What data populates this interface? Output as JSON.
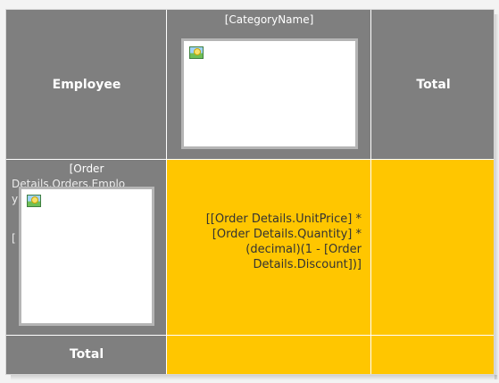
{
  "header_row": {
    "employee_label": "Employee",
    "category_placeholder": "[CategoryName]",
    "total_label": "Total"
  },
  "data_row": {
    "order_placeholder_top": "[Order",
    "order_placeholder_hidden_line1": "Details.Orders.Emplo",
    "order_placeholder_hidden_line2": "y",
    "order_placeholder_hidden_line3": "",
    "order_placeholder_hidden_line4": "[",
    "expression": "[[Order Details.UnitPrice] * [Order Details.Quantity] * (decimal)(1 - [Order Details.Discount])]"
  },
  "footer_row": {
    "total_label": "Total"
  },
  "icons": {
    "picture": "picture-icon"
  },
  "colors": {
    "header_gray": "#7f7f7f",
    "data_gold": "#ffc600",
    "border_white": "#ffffff",
    "frame_gray": "#b5b5b5"
  }
}
